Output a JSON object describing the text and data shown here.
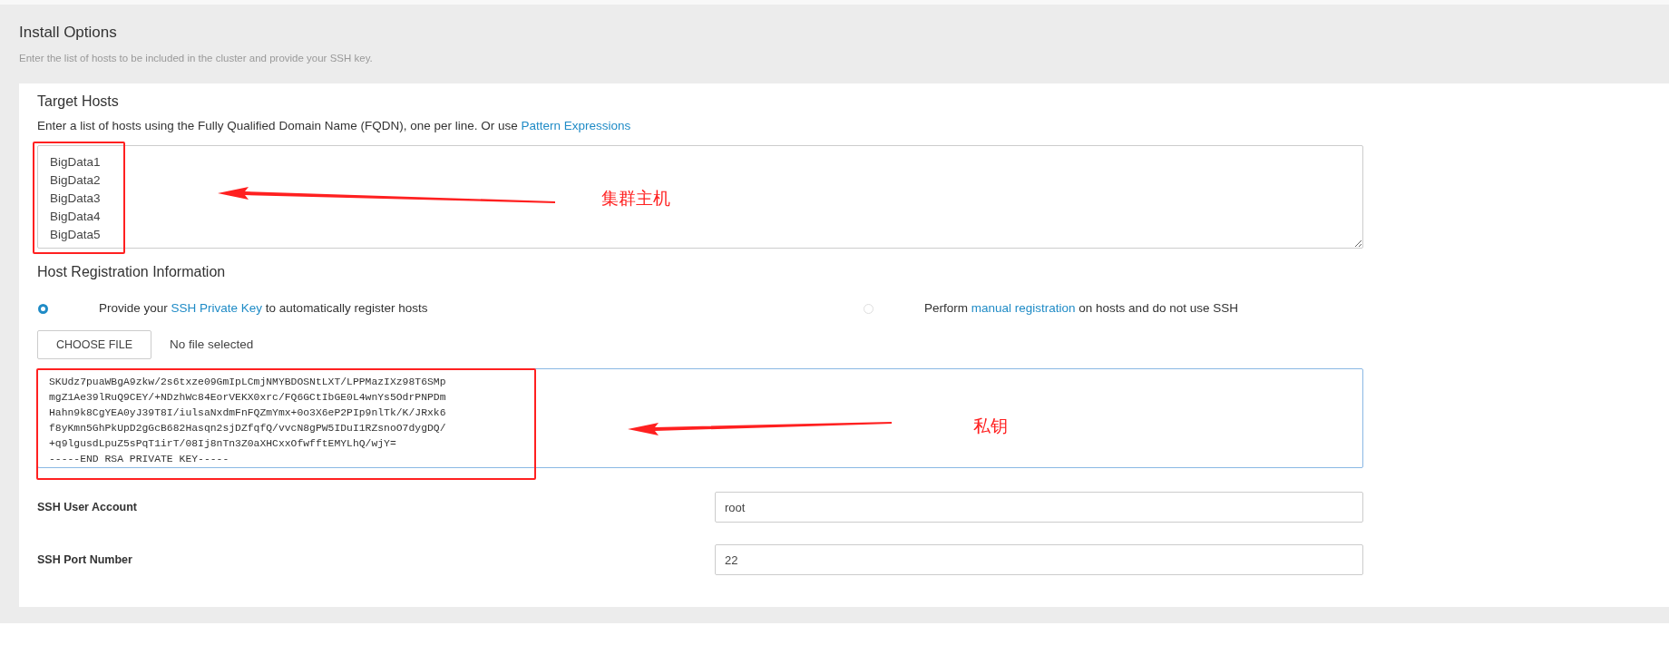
{
  "header": {
    "title": "Install Options",
    "subtitle": "Enter the list of hosts to be included in the cluster and provide your SSH key."
  },
  "target_hosts": {
    "title": "Target Hosts",
    "description": "Enter a list of hosts using the Fully Qualified Domain Name (FQDN), one per line. Or use ",
    "link": "Pattern Expressions",
    "value": [
      "BigData1",
      "BigData2",
      "BigData3",
      "BigData4",
      "BigData5"
    ]
  },
  "host_registration": {
    "title": "Host Registration Information",
    "options": [
      {
        "before": "Provide your ",
        "link": "SSH Private Key",
        "after": " to automatically register hosts",
        "selected": true
      },
      {
        "before": "Perform ",
        "link": "manual registration",
        "after": " on hosts and do not use SSH",
        "selected": false
      }
    ],
    "choose_file": "CHOOSE FILE",
    "file_status": "No file selected",
    "key_lines": [
      "SKUdz7puaWBgA9zkw/2s6txze09GmIpLCmjNMYBDOSNtLXT/LPPMazIXz98T6SMp",
      "mgZ1Ae39lRuQ9CEY/+NDzhWc84EorVEKX0xrc/FQ6GCtIbGE0L4wnYs5OdrPNPDm",
      "Hahn9k8CgYEA0yJ39T8I/iulsaNxdmFnFQZmYmx+0o3X6eP2PIp9nlTk/K/JRxk6",
      "f8yKmn5GhPkUpD2gGcB682Hasqn2sjDZfqfQ/vvcN8gPW5IDuI1RZsnoO7dygDQ/",
      "+q9lgusdLpuZ5sPqT1irT/08Ij8nTn3Z0aXHCxxOfwfftEMYLhQ/wjY=",
      "-----END RSA PRIVATE KEY-----"
    ],
    "fields": [
      {
        "label": "SSH User Account",
        "value": "root"
      },
      {
        "label": "SSH Port Number",
        "value": "22"
      }
    ]
  },
  "annotations": [
    {
      "text": "集群主机"
    },
    {
      "text": "私钥"
    }
  ]
}
